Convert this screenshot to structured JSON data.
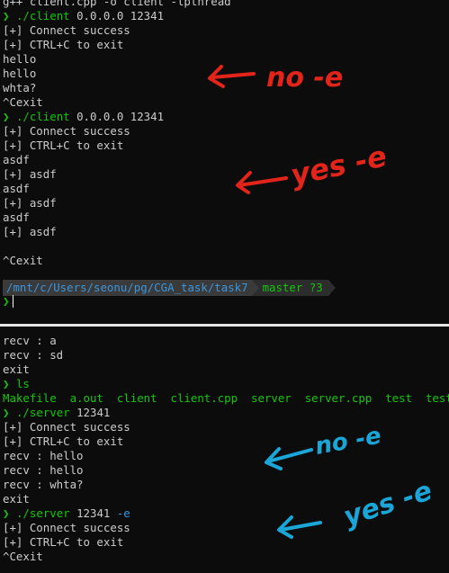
{
  "top": {
    "lines": [
      {
        "kind": "plain",
        "text": "g++ client.cpp -o client -lpthread"
      },
      {
        "kind": "cmd",
        "arrow": "❯",
        "cmd": "./client",
        "args": " 0.0.0.0 12341"
      },
      {
        "kind": "plain",
        "text": "[+] Connect success"
      },
      {
        "kind": "plain",
        "text": "[+] CTRL+C to exit"
      },
      {
        "kind": "plain",
        "text": "hello"
      },
      {
        "kind": "plain",
        "text": "hello"
      },
      {
        "kind": "plain",
        "text": "whta?"
      },
      {
        "kind": "plain",
        "text": "^Cexit"
      },
      {
        "kind": "cmd",
        "arrow": "❯",
        "cmd": "./client",
        "args": " 0.0.0.0 12341"
      },
      {
        "kind": "plain",
        "text": "[+] Connect success"
      },
      {
        "kind": "plain",
        "text": "[+] CTRL+C to exit"
      },
      {
        "kind": "plain",
        "text": "asdf"
      },
      {
        "kind": "plain",
        "text": "[+] asdf"
      },
      {
        "kind": "plain",
        "text": "asdf"
      },
      {
        "kind": "plain",
        "text": "[+] asdf"
      },
      {
        "kind": "plain",
        "text": "asdf"
      },
      {
        "kind": "plain",
        "text": "[+] asdf"
      },
      {
        "kind": "plain",
        "text": ""
      },
      {
        "kind": "plain",
        "text": "^Cexit"
      }
    ],
    "prompt": {
      "path_parts": [
        "/mnt",
        "/c",
        "/Users",
        "/seonu",
        "/pg",
        "/CGA_task",
        "/task7"
      ],
      "branch": "master",
      "status": "?3",
      "input_arrow": "❯"
    },
    "annotations": {
      "no_e": "no -e",
      "yes_e": "yes -e",
      "color": "#e3241b"
    }
  },
  "bottom": {
    "lines": [
      {
        "kind": "plain",
        "text": "recv : a"
      },
      {
        "kind": "plain",
        "text": "recv : sd"
      },
      {
        "kind": "plain",
        "text": "exit"
      },
      {
        "kind": "cmd",
        "arrow": "❯",
        "cmd": "ls",
        "args": ""
      },
      {
        "kind": "files",
        "text": "Makefile  a.out  client  client.cpp  server  server.cpp  test  test.c"
      },
      {
        "kind": "cmd",
        "arrow": "❯",
        "cmd": "./server",
        "args": " 12341"
      },
      {
        "kind": "plain",
        "text": "[+] Connect success"
      },
      {
        "kind": "plain",
        "text": "[+] CTRL+C to exit"
      },
      {
        "kind": "plain",
        "text": "recv : hello"
      },
      {
        "kind": "plain",
        "text": "recv : hello"
      },
      {
        "kind": "plain",
        "text": "recv : whta?"
      },
      {
        "kind": "plain",
        "text": "exit"
      },
      {
        "kind": "cmd",
        "arrow": "❯",
        "cmd": "./server",
        "args": " 12341 ",
        "flag": "-e"
      },
      {
        "kind": "plain",
        "text": "[+] Connect success"
      },
      {
        "kind": "plain",
        "text": "[+] CTRL+C to exit"
      },
      {
        "kind": "plain",
        "text": "^Cexit"
      }
    ],
    "annotations": {
      "no_e": "no -e",
      "yes_e": "yes -e",
      "color": "#1aa6d6"
    }
  }
}
